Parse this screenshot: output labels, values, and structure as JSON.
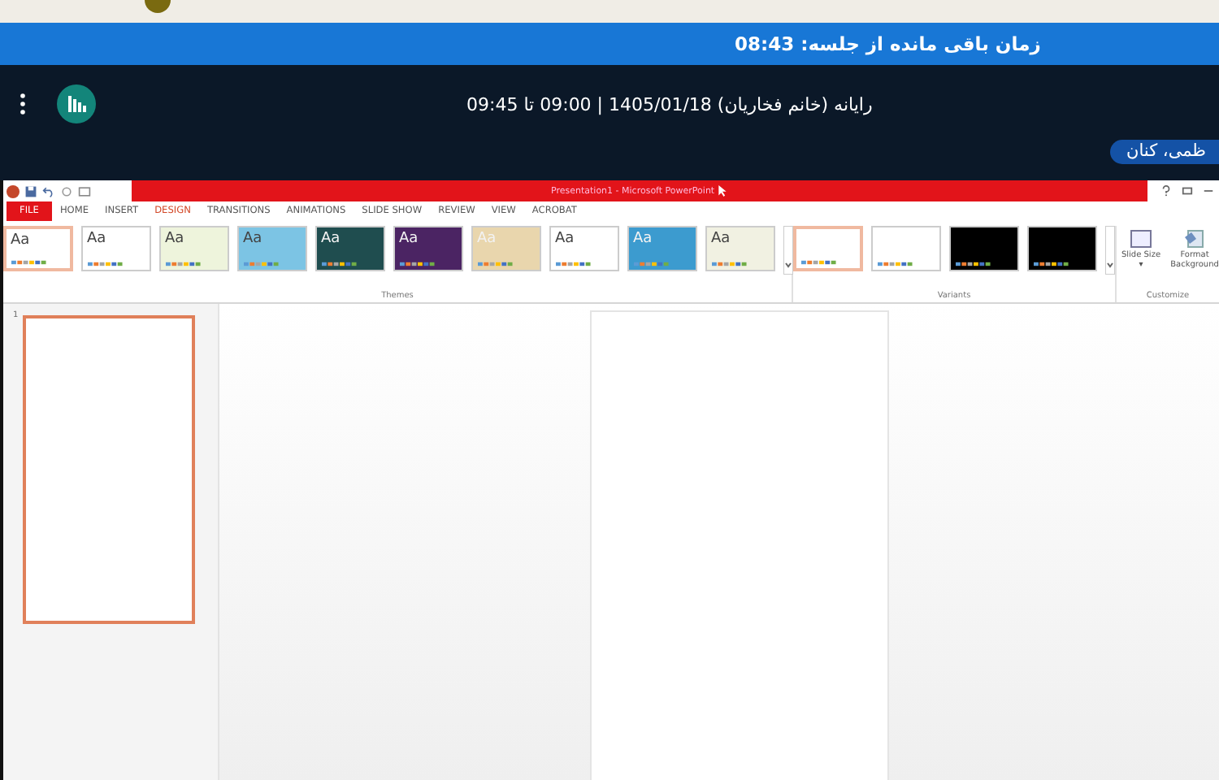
{
  "session_banner": {
    "text": "زمان باقی مانده از جلسه: 08:43"
  },
  "header": {
    "title": "رایانه (خانم فخاریان) 1405/01/18 | 09:00 تا 09:45",
    "participant_chip": "ظمی، کنان"
  },
  "ppt": {
    "title": "Presentation1 - Microsoft PowerPoint",
    "tabs": [
      {
        "label": "FILE",
        "kind": "file",
        "selected": false
      },
      {
        "label": "HOME",
        "kind": "tab",
        "selected": false
      },
      {
        "label": "INSERT",
        "kind": "tab",
        "selected": false
      },
      {
        "label": "DESIGN",
        "kind": "tab",
        "selected": true
      },
      {
        "label": "TRANSITIONS",
        "kind": "tab",
        "selected": false
      },
      {
        "label": "ANIMATIONS",
        "kind": "tab",
        "selected": false
      },
      {
        "label": "SLIDE SHOW",
        "kind": "tab",
        "selected": false
      },
      {
        "label": "REVIEW",
        "kind": "tab",
        "selected": false
      },
      {
        "label": "VIEW",
        "kind": "tab",
        "selected": false
      },
      {
        "label": "ACROBAT",
        "kind": "tab",
        "selected": false
      }
    ],
    "themes": [
      {
        "label": "Aa",
        "color": "#ffffff",
        "dark": false,
        "selected": true
      },
      {
        "label": "Aa",
        "color": "#ffffff",
        "dark": false,
        "selected": false
      },
      {
        "label": "Aa",
        "color": "#eef4dc",
        "dark": false,
        "selected": false
      },
      {
        "label": "Aa",
        "color": "#7cc4e4",
        "dark": false,
        "selected": false
      },
      {
        "label": "Aa",
        "color": "#1f4d4f",
        "dark": true,
        "selected": false
      },
      {
        "label": "Aa",
        "color": "#4b2463",
        "dark": true,
        "selected": false
      },
      {
        "label": "Aa",
        "color": "#e9d6ad",
        "dark": true,
        "selected": false
      },
      {
        "label": "Aa",
        "color": "#ffffff",
        "dark": false,
        "selected": false
      },
      {
        "label": "Aa",
        "color": "#3c9bcf",
        "dark": true,
        "selected": false
      },
      {
        "label": "Aa",
        "color": "#f1f1e2",
        "dark": false,
        "selected": false
      }
    ],
    "themes_label": "Themes",
    "variants": [
      {
        "color": "#ffffff",
        "selected": true
      },
      {
        "color": "#ffffff",
        "selected": false
      },
      {
        "color": "#000000",
        "selected": false
      },
      {
        "color": "#000000",
        "selected": false
      }
    ],
    "variants_label": "Variants",
    "customize": [
      {
        "label": "Slide Size ▾",
        "kind": "slide-size"
      },
      {
        "label": "Format Background",
        "kind": "format-bg"
      }
    ],
    "customize_label": "Customize",
    "slide_number": "1"
  }
}
